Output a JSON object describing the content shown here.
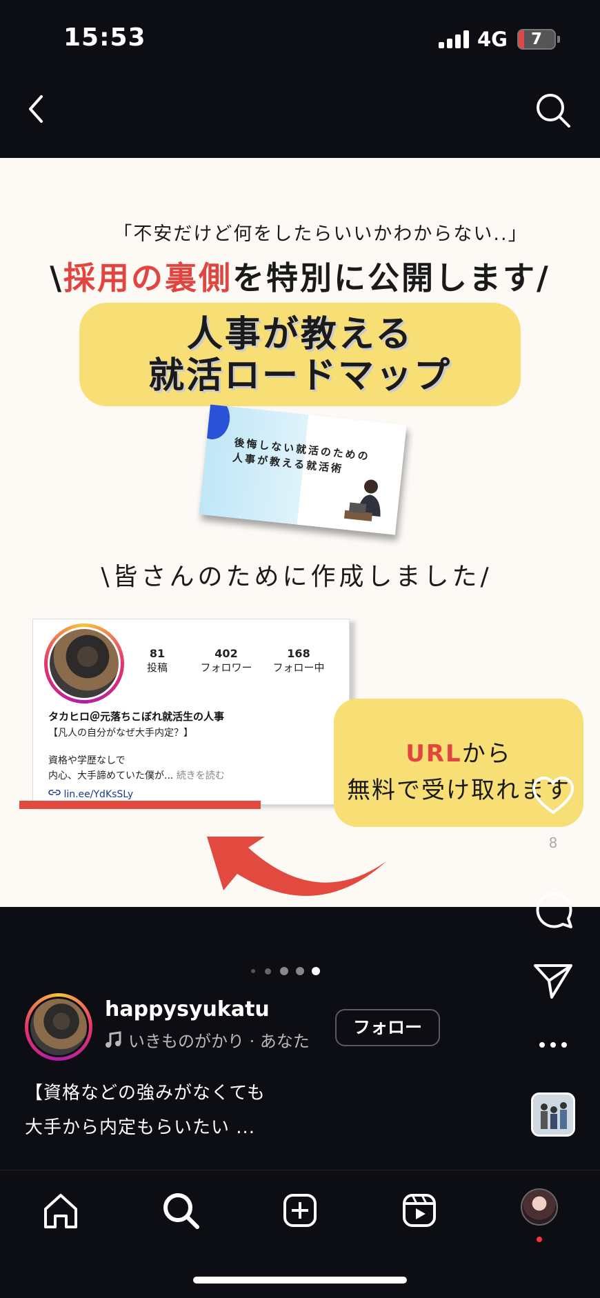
{
  "status_bar": {
    "time": "15:53",
    "network": "4G",
    "battery": "7"
  },
  "post": {
    "quote": "「不安だけど何をしたらいいかわからない..」",
    "headline_prefix": "\\",
    "headline_red": "採用の裏側",
    "headline_rest": "を特別に公開します",
    "headline_suffix": "/",
    "yellow_line1": "人事が教える",
    "yellow_line2": "就活ロードマップ",
    "mockup_line1": "後悔しない就活のための",
    "mockup_line2": "人事が教える就活術",
    "made_for_you": "\\皆さんのために作成しました/",
    "profile_card": {
      "posts_count": "81",
      "posts_label": "投稿",
      "followers_count": "402",
      "followers_label": "フォロワー",
      "following_count": "168",
      "following_label": "フォロー中",
      "name": "タカヒロ＠元落ちこぼれ就活生の人事",
      "bio_line1": "【凡人の自分がなぜ大手内定？】",
      "bio_line2": "資格や学歴なしで",
      "bio_line3": "内心、大手諦めていた僕が...",
      "read_more": " 続きを読む",
      "link": "lin.ee/YdKsSLy"
    },
    "url_bubble": {
      "red": "URL",
      "rest": "から",
      "line2": "無料で受け取れます"
    }
  },
  "actions": {
    "like_count": "8"
  },
  "carousel": {
    "total_dots": 5,
    "active_index": 4
  },
  "author": {
    "username": "happysyukatu",
    "music": "いきものがかり · あなた",
    "follow_label": "フォロー"
  },
  "caption": {
    "line1": "【資格などの強みがなくても",
    "line2": "大手から内定もらいたい ..."
  },
  "colors": {
    "accent_red": "#e0463f",
    "highlight_yellow": "#f7df75",
    "background": "#0d0e14"
  },
  "icons": [
    "back-icon",
    "search-icon",
    "heart-icon",
    "comment-icon",
    "share-icon",
    "more-icon",
    "music-icon",
    "home-icon",
    "explore-icon",
    "create-icon",
    "reels-icon",
    "link-icon"
  ]
}
